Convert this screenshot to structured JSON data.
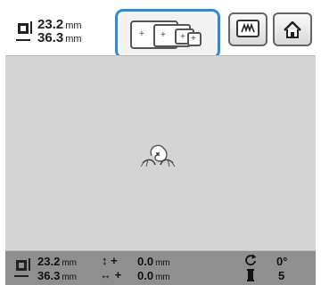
{
  "top_bar": {
    "size_icon": "design-size-icon",
    "height_value": "23.2",
    "height_unit": "mm",
    "width_value": "36.3",
    "width_unit": "mm",
    "zoom_selector_icon": "frame-size-selector-icon",
    "zoom_highlight_color": "#2c8ad8",
    "buttons": [
      {
        "name": "embroidery-mode-button",
        "icon": "embroidery-mode-icon"
      },
      {
        "name": "home-button",
        "icon": "home-icon"
      }
    ]
  },
  "canvas": {
    "background": "#d4d4d4",
    "design_icon": "embroidery-design-preview-icon"
  },
  "status_bar": {
    "size_icon": "design-size-icon",
    "height_value": "23.2",
    "height_unit": "mm",
    "width_value": "36.3",
    "width_unit": "mm",
    "vertical_offset_icon": "vertical-offset-icon",
    "vertical_offset_value": "0.0",
    "vertical_offset_unit": "mm",
    "horizontal_offset_icon": "horizontal-offset-icon",
    "horizontal_offset_value": "0.0",
    "horizontal_offset_unit": "mm",
    "rotation_icon": "rotate-icon",
    "rotation_value": "0°",
    "thread_icon": "thread-spool-icon",
    "thread_count": "5"
  }
}
